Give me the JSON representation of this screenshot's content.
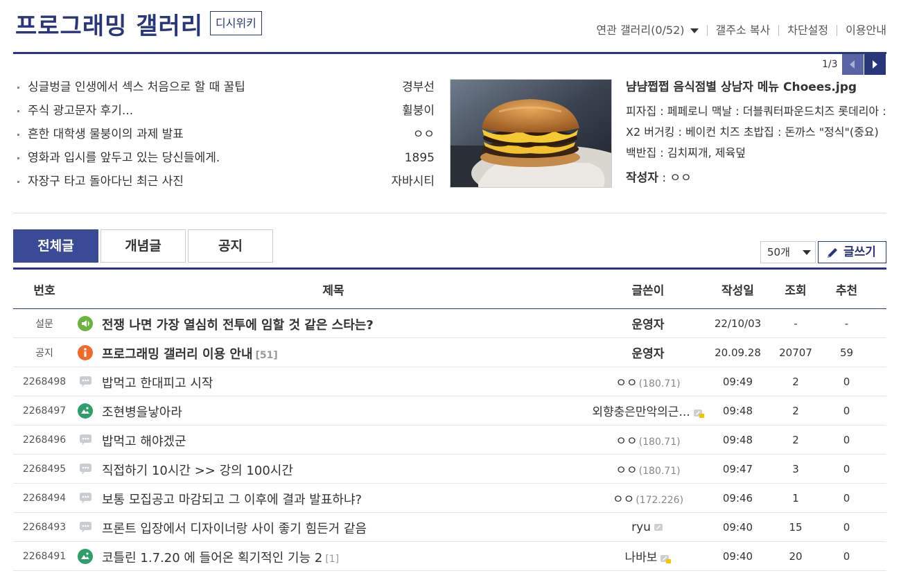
{
  "header": {
    "title": "프로그래밍 갤러리",
    "wiki_label": "디시위키",
    "links": [
      "연관 갤러리(0/52)",
      "갤주소 복사",
      "차단설정",
      "이용안내"
    ]
  },
  "pager": {
    "text": "1/3"
  },
  "concept_posts": [
    {
      "title": "싱글벙글 인생에서 섹스 처음으로 할 때 꿀팁",
      "author": "경부선"
    },
    {
      "title": "주식 광고문자 후기...",
      "author": "휠붕이"
    },
    {
      "title": "흔한 대학생 물붕이의 과제 발표",
      "author": "ㅇㅇ"
    },
    {
      "title": "영화과 입시를 앞두고 있는 당신들에게.",
      "author": "1895"
    },
    {
      "title": "자장구 타고 돌아다닌 최근 사진",
      "author": "자바시티"
    }
  ],
  "featured": {
    "title": "냠냠쩝쩝 음식점별 상남자 메뉴 Choees.jpg",
    "description": "피자집 : 페페로니 맥날 : 더블쿼터파운드치즈 롯데리아 : X2 버거킹 : 베이컨 치즈 초밥집 : 돈까스 \"정식\"(중요) 백반집 : 김치찌개, 제육덮",
    "author_label": "작성자",
    "author_sep": " : ",
    "author": "ㅇㅇ"
  },
  "tabs": [
    "전체글",
    "개념글",
    "공지"
  ],
  "list_size": "50개",
  "write_label": "글쓰기",
  "columns": [
    "번호",
    "제목",
    "글쓴이",
    "작성일",
    "조회",
    "추천"
  ],
  "rows": [
    {
      "num": "설문",
      "icon": "speaker-icon",
      "title": "전쟁 나면 가장 열심히 전투에 임할 것 같은 스타는?",
      "reply": "",
      "bold": true,
      "writer": "운영자",
      "ip": "",
      "badge": "",
      "date": "22/10/03",
      "views": "-",
      "rec": "-"
    },
    {
      "num": "공지",
      "icon": "info-icon",
      "title": "프로그래밍 갤러리 이용 안내",
      "reply": "[51]",
      "bold": true,
      "writer": "운영자",
      "ip": "",
      "badge": "",
      "date": "20.09.28",
      "views": "20707",
      "rec": "59"
    },
    {
      "num": "2268498",
      "icon": "speech-icon",
      "title": "밥먹고 한대피고 시작",
      "reply": "",
      "bold": false,
      "writer": "ㅇㅇ",
      "ip": "(180.71)",
      "badge": "",
      "date": "09:49",
      "views": "2",
      "rec": "0"
    },
    {
      "num": "2268497",
      "icon": "image-icon",
      "title": "조현병을낳아라",
      "reply": "",
      "bold": false,
      "writer": "외향충은만악의근...",
      "ip": "",
      "badge": "fixed-nick-badge-icon",
      "date": "09:48",
      "views": "2",
      "rec": "0"
    },
    {
      "num": "2268496",
      "icon": "speech-icon",
      "title": "밥먹고 해야겠군",
      "reply": "",
      "bold": false,
      "writer": "ㅇㅇ",
      "ip": "(180.71)",
      "badge": "",
      "date": "09:48",
      "views": "2",
      "rec": "0"
    },
    {
      "num": "2268495",
      "icon": "speech-icon",
      "title": "직접하기 10시간 >> 강의 100시간",
      "reply": "",
      "bold": false,
      "writer": "ㅇㅇ",
      "ip": "(180.71)",
      "badge": "",
      "date": "09:47",
      "views": "3",
      "rec": "0"
    },
    {
      "num": "2268494",
      "icon": "speech-icon",
      "title": "보통 모집공고 마감되고 그 이후에 결과 발표하냐?",
      "reply": "",
      "bold": false,
      "writer": "ㅇㅇ",
      "ip": "(172.226)",
      "badge": "",
      "date": "09:46",
      "views": "1",
      "rec": "0"
    },
    {
      "num": "2268493",
      "icon": "speech-icon",
      "title": "프론트 입장에서 디자이너랑 사이 좋기 힘든거 같음",
      "reply": "",
      "bold": false,
      "writer": "ryu",
      "ip": "",
      "badge": "half-fixed-nick-badge-icon",
      "date": "09:40",
      "views": "15",
      "rec": "0"
    },
    {
      "num": "2268491",
      "icon": "image-icon",
      "title": "코틀린 1.7.20 에 들어온 획기적인 기능 2",
      "reply": "[1]",
      "bold": false,
      "writer": "나바보",
      "ip": "",
      "badge": "fixed-nick-badge-icon",
      "date": "09:40",
      "views": "20",
      "rec": "0"
    }
  ]
}
